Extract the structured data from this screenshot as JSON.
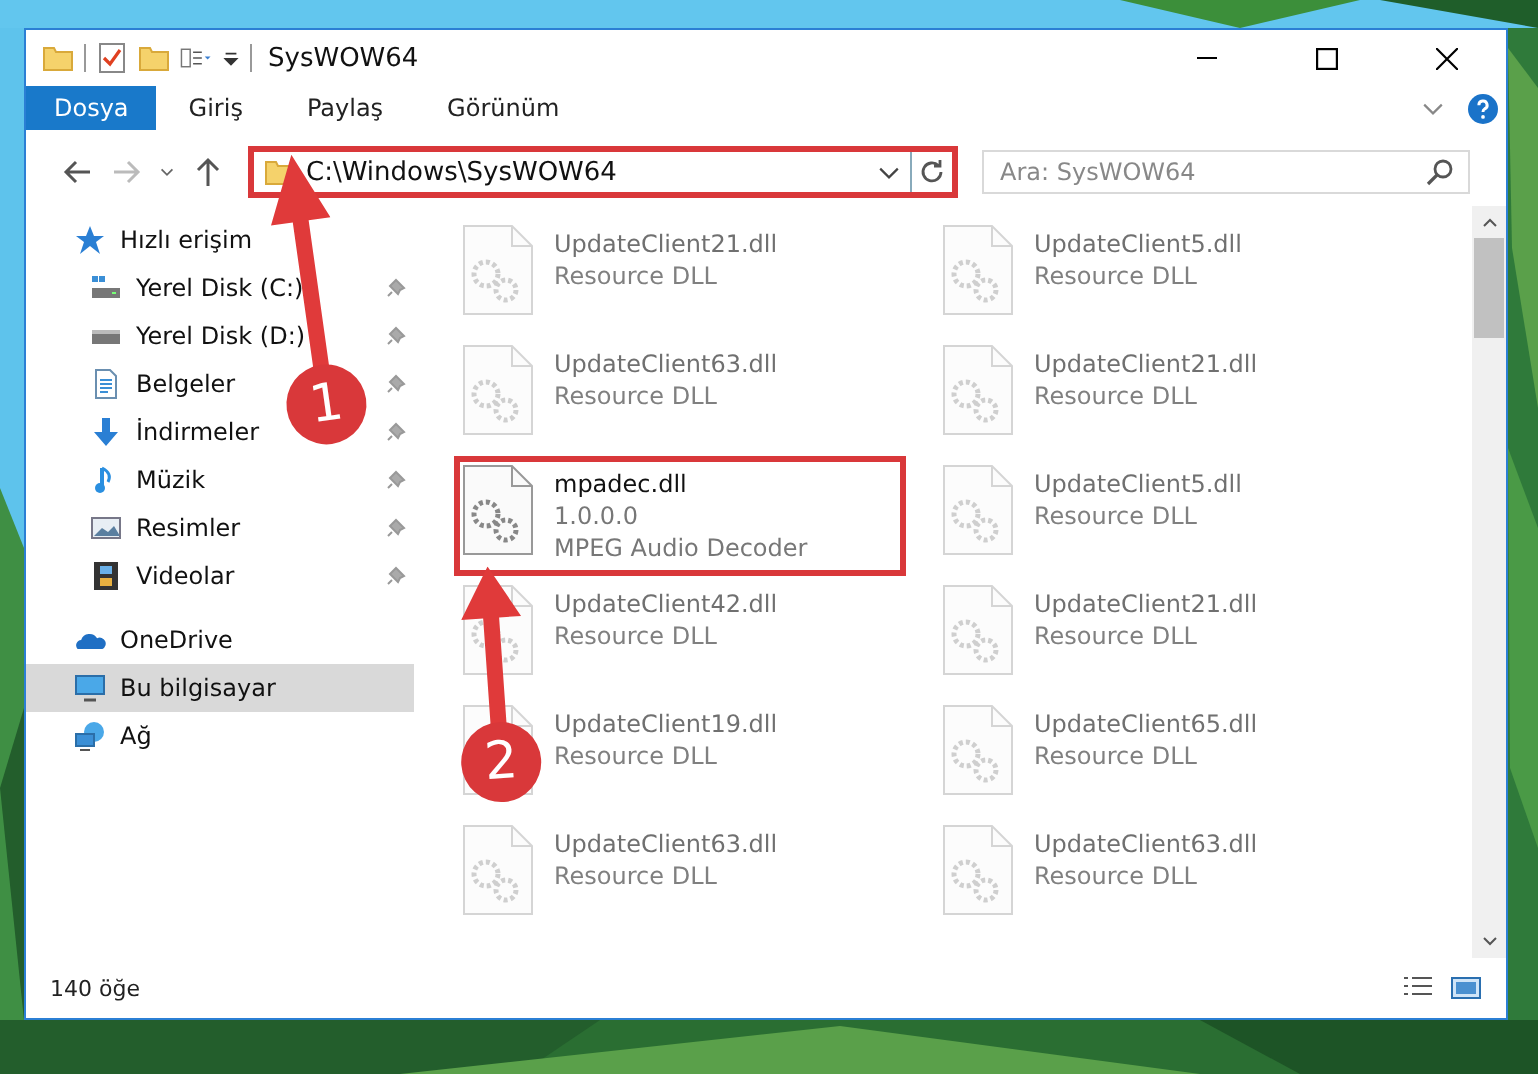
{
  "window": {
    "title": "SysWOW64"
  },
  "ribbon_tabs": [
    {
      "label": "Dosya",
      "selected": true
    },
    {
      "label": "Giriş",
      "selected": false
    },
    {
      "label": "Paylaş",
      "selected": false
    },
    {
      "label": "Görünüm",
      "selected": false
    }
  ],
  "address": {
    "path": "C:\\Windows\\SysWOW64",
    "highlighted": true
  },
  "search": {
    "placeholder": "Ara: SysWOW64"
  },
  "nav": [
    {
      "label": "Hızlı erişim",
      "kind": "star",
      "selected": false,
      "children": [
        {
          "label": "Yerel Disk (C:)",
          "kind": "system-disk",
          "pinned": true
        },
        {
          "label": "Yerel Disk (D:)",
          "kind": "disk",
          "pinned": true
        },
        {
          "label": "Belgeler",
          "kind": "document",
          "pinned": true
        },
        {
          "label": "İndirmeler",
          "kind": "download",
          "pinned": true
        },
        {
          "label": "Müzik",
          "kind": "music",
          "pinned": true
        },
        {
          "label": "Resimler",
          "kind": "pictures",
          "pinned": true
        },
        {
          "label": "Videolar",
          "kind": "video",
          "pinned": true
        }
      ]
    },
    {
      "label": "OneDrive",
      "kind": "cloud",
      "selected": false
    },
    {
      "label": "Bu bilgisayar",
      "kind": "computer",
      "selected": true
    },
    {
      "label": "Ağ",
      "kind": "network",
      "selected": false
    }
  ],
  "files": [
    {
      "name": "UpdateClient21.dll",
      "details": [
        "Resource DLL"
      ],
      "highlighted": false
    },
    {
      "name": "UpdateClient5.dll",
      "details": [
        "Resource DLL"
      ],
      "highlighted": false
    },
    {
      "name": "UpdateClient63.dll",
      "details": [
        "Resource DLL"
      ],
      "highlighted": false
    },
    {
      "name": "UpdateClient21.dll",
      "details": [
        "Resource DLL"
      ],
      "highlighted": false
    },
    {
      "name": "mpadec.dll",
      "details": [
        "1.0.0.0",
        "MPEG Audio Decoder"
      ],
      "highlighted": true
    },
    {
      "name": "UpdateClient5.dll",
      "details": [
        "Resource DLL"
      ],
      "highlighted": false
    },
    {
      "name": "UpdateClient42.dll",
      "details": [
        "Resource DLL"
      ],
      "highlighted": false
    },
    {
      "name": "UpdateClient21.dll",
      "details": [
        "Resource DLL"
      ],
      "highlighted": false
    },
    {
      "name": "UpdateClient19.dll",
      "details": [
        "Resource DLL"
      ],
      "highlighted": false
    },
    {
      "name": "UpdateClient65.dll",
      "details": [
        "Resource DLL"
      ],
      "highlighted": false
    },
    {
      "name": "UpdateClient63.dll",
      "details": [
        "Resource DLL"
      ],
      "highlighted": false
    },
    {
      "name": "UpdateClient63.dll",
      "details": [
        "Resource DLL"
      ],
      "highlighted": false
    }
  ],
  "status_bar": {
    "item_count": "140 öğe"
  },
  "annotations": [
    {
      "number": "1"
    },
    {
      "number": "2"
    }
  ]
}
